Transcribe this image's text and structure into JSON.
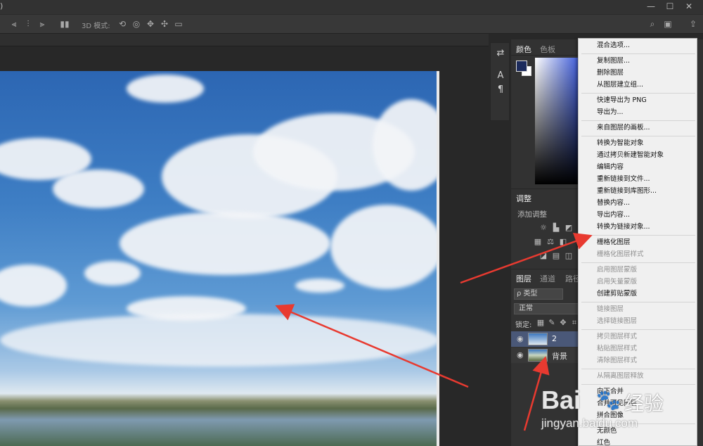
{
  "window": {
    "title_fragment": ")",
    "controls": [
      "—",
      "☐",
      "✕"
    ]
  },
  "options_bar": {
    "mode_3d_label": "3D 模式:"
  },
  "panels": {
    "color": {
      "tabs": [
        "颜色",
        "色板"
      ],
      "fg_color": "#1c2b5c",
      "bg_color": "#ffffff"
    },
    "adjust": {
      "tab": "调整",
      "add_label": "添加调整"
    },
    "layers": {
      "tabs": [
        "图层",
        "通道",
        "路径"
      ],
      "filter_label": "ρ 类型",
      "blend_mode": "正常",
      "lock_label": "锁定:",
      "rows": [
        {
          "name": "2",
          "selected": true
        },
        {
          "name": "背景",
          "selected": false
        }
      ]
    }
  },
  "context_menu": {
    "items": [
      {
        "label": "混合选项...",
        "enabled": true
      },
      {
        "sep": true
      },
      {
        "label": "复制图层...",
        "enabled": true
      },
      {
        "label": "删除图层",
        "enabled": true
      },
      {
        "label": "从图层建立组...",
        "enabled": true
      },
      {
        "sep": true
      },
      {
        "label": "快速导出为 PNG",
        "enabled": true
      },
      {
        "label": "导出为...",
        "enabled": true
      },
      {
        "sep": true
      },
      {
        "label": "来自图层的画板...",
        "enabled": true
      },
      {
        "sep": true
      },
      {
        "label": "转换为智能对象",
        "enabled": true
      },
      {
        "label": "通过拷贝新建智能对象",
        "enabled": true
      },
      {
        "label": "编辑内容",
        "enabled": true
      },
      {
        "label": "重新链接到文件...",
        "enabled": true
      },
      {
        "label": "重新链接到库图形...",
        "enabled": true
      },
      {
        "label": "替换内容...",
        "enabled": true
      },
      {
        "label": "导出内容...",
        "enabled": true
      },
      {
        "label": "转换为链接对象...",
        "enabled": true
      },
      {
        "sep": true
      },
      {
        "label": "栅格化图层",
        "enabled": true
      },
      {
        "label": "栅格化图层样式",
        "enabled": false
      },
      {
        "sep": true
      },
      {
        "label": "启用图层蒙版",
        "enabled": false
      },
      {
        "label": "启用矢量蒙版",
        "enabled": false
      },
      {
        "label": "创建剪贴蒙版",
        "enabled": true
      },
      {
        "sep": true
      },
      {
        "label": "链接图层",
        "enabled": false
      },
      {
        "label": "选择链接图层",
        "enabled": false
      },
      {
        "sep": true
      },
      {
        "label": "拷贝图层样式",
        "enabled": false
      },
      {
        "label": "粘贴图层样式",
        "enabled": false
      },
      {
        "label": "清除图层样式",
        "enabled": false
      },
      {
        "sep": true
      },
      {
        "label": "从隔离图层释放",
        "enabled": false
      },
      {
        "sep": true
      },
      {
        "label": "向下合并",
        "enabled": true
      },
      {
        "label": "合并可见图层",
        "enabled": true
      },
      {
        "label": "拼合图像",
        "enabled": true
      },
      {
        "sep": true
      },
      {
        "label": "无颜色",
        "enabled": true
      },
      {
        "label": "红色",
        "enabled": true
      }
    ]
  },
  "watermark": {
    "brand": "Bai",
    "brand2": "经验",
    "url": "jingyan.baidu.com"
  },
  "colors": {
    "arrow": "#e83a30",
    "menu_bg": "#f0f0f0",
    "panel_bg": "#323232"
  }
}
